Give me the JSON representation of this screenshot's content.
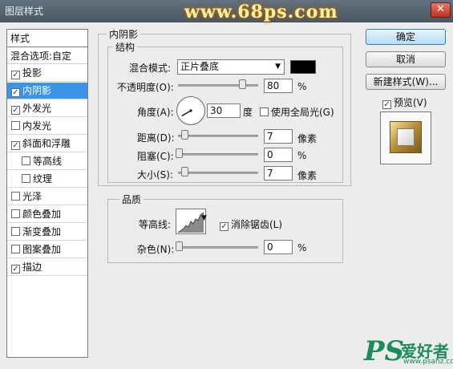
{
  "window": {
    "title": "图层样式",
    "watermark": "www.68ps.com",
    "close": "✕"
  },
  "sidebar": {
    "header": "样式",
    "blend_options": "混合选项:自定",
    "items": [
      {
        "label": "投影",
        "checked": true
      },
      {
        "label": "内阴影",
        "checked": true,
        "selected": true
      },
      {
        "label": "外发光",
        "checked": true
      },
      {
        "label": "内发光",
        "checked": false
      },
      {
        "label": "斜面和浮雕",
        "checked": true
      },
      {
        "label": "等高线",
        "checked": false,
        "indent": true
      },
      {
        "label": "纹理",
        "checked": false,
        "indent": true
      },
      {
        "label": "光泽",
        "checked": false
      },
      {
        "label": "颜色叠加",
        "checked": false
      },
      {
        "label": "渐变叠加",
        "checked": false
      },
      {
        "label": "图案叠加",
        "checked": false
      },
      {
        "label": "描边",
        "checked": true
      }
    ]
  },
  "panel": {
    "title": "内阴影",
    "structure": {
      "label": "结构",
      "blend_mode_label": "混合模式:",
      "blend_mode_value": "正片叠底",
      "blend_color": "#000000",
      "opacity_label": "不透明度(O):",
      "opacity_value": "80",
      "opacity_unit": "%",
      "opacity_level": 0.8,
      "angle_label": "角度(A):",
      "angle_value": "30",
      "angle_unit": "度",
      "global_light_label": "使用全局光(G)",
      "distance_label": "距离(D):",
      "distance_value": "7",
      "distance_unit": "像素",
      "choke_label": "阻塞(C):",
      "choke_value": "0",
      "choke_unit": "%",
      "size_label": "大小(S):",
      "size_value": "7",
      "size_unit": "像素"
    },
    "quality": {
      "label": "品质",
      "contour_label": "等高线:",
      "antialias_label": "消除锯齿(L)",
      "noise_label": "杂色(N):",
      "noise_value": "0",
      "noise_unit": "%"
    }
  },
  "buttons": {
    "ok": "确定",
    "cancel": "取消",
    "new_style": "新建样式(W)...",
    "preview_label": "预览(V)"
  },
  "watermark_logo": {
    "ps": "PS",
    "text": "爱好者",
    "url": "www.psahz.com"
  }
}
